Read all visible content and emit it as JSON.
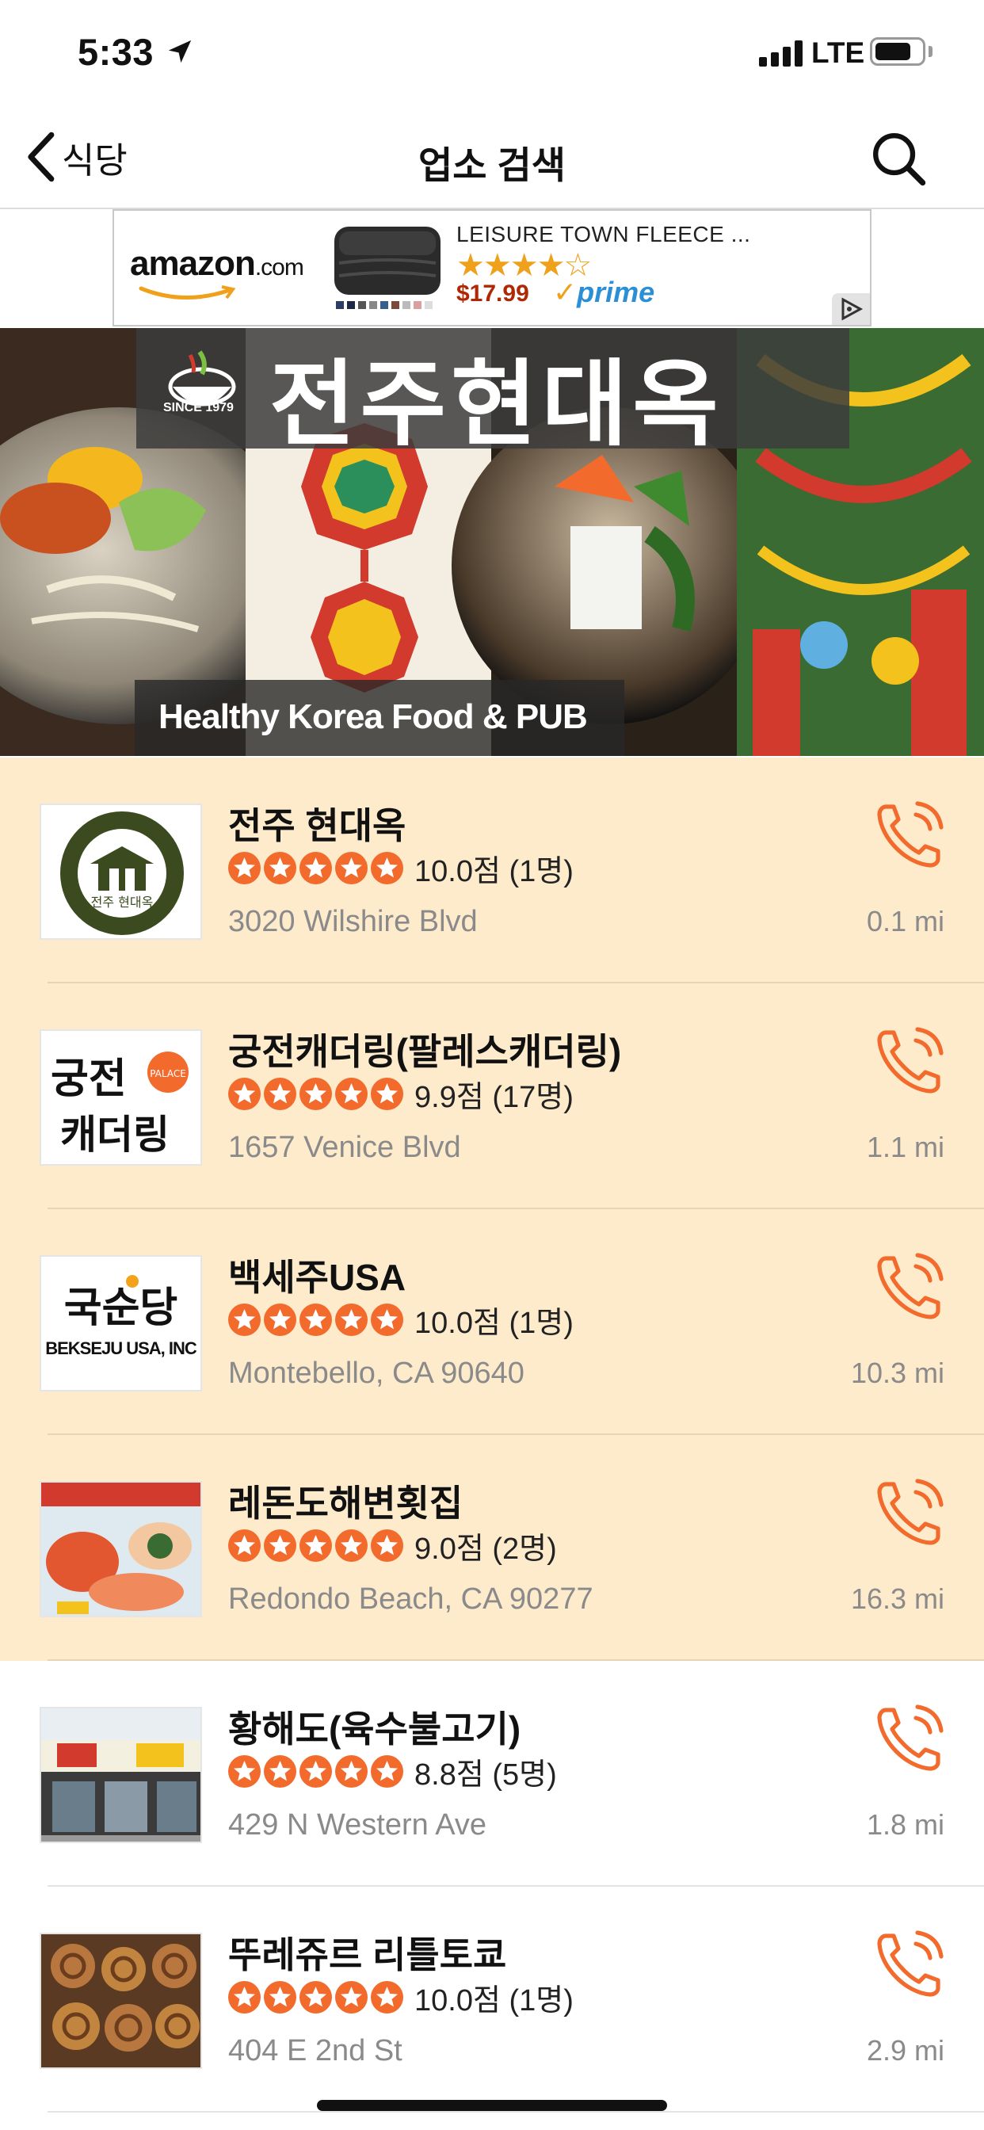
{
  "status_bar": {
    "time": "5:33",
    "network": "LTE"
  },
  "nav": {
    "back_label": "식당",
    "title": "업소 검색"
  },
  "ad": {
    "brand": "amazon",
    "brand_suffix": ".com",
    "product_title": "LEISURE TOWN FLEECE ...",
    "rating_stars": "★★★★☆",
    "price": "$17.99",
    "prime_label": "prime"
  },
  "hero": {
    "title": "전주현대옥",
    "since": "SINCE 1979",
    "subtitle": "Healthy Korea  Food & PUB"
  },
  "colors": {
    "accent": "#f26b2c",
    "highlight_row": "#fdebcc",
    "secondary_text": "#8a8a8a"
  },
  "listings": [
    {
      "name": "전주 현대옥",
      "stars": 5,
      "score": "10.0점 (1명)",
      "address": "3020 Wilshire Blvd",
      "distance": "0.1 mi",
      "highlighted": true
    },
    {
      "name": "궁전캐더링(팔레스캐더링)",
      "stars": 5,
      "score": "9.9점 (17명)",
      "address": "1657 Venice Blvd",
      "distance": "1.1 mi",
      "highlighted": true
    },
    {
      "name": "백세주USA",
      "stars": 5,
      "score": "10.0점 (1명)",
      "address": "Montebello, CA 90640",
      "distance": "10.3 mi",
      "highlighted": true,
      "thumb_text": "국순당",
      "thumb_sub": "BEKSEJU USA, INC"
    },
    {
      "name": "레돈도해변횟집",
      "stars": 5,
      "score": "9.0점 (2명)",
      "address": "Redondo Beach, CA 90277",
      "distance": "16.3 mi",
      "highlighted": true
    },
    {
      "name": "황해도(육수불고기)",
      "stars": 5,
      "score": "8.8점 (5명)",
      "address": "429 N Western Ave",
      "distance": "1.8 mi",
      "highlighted": false
    },
    {
      "name": "뚜레쥬르 리틀토쿄",
      "stars": 5,
      "score": "10.0점 (1명)",
      "address": "404 E 2nd St",
      "distance": "2.9 mi",
      "highlighted": false
    }
  ]
}
